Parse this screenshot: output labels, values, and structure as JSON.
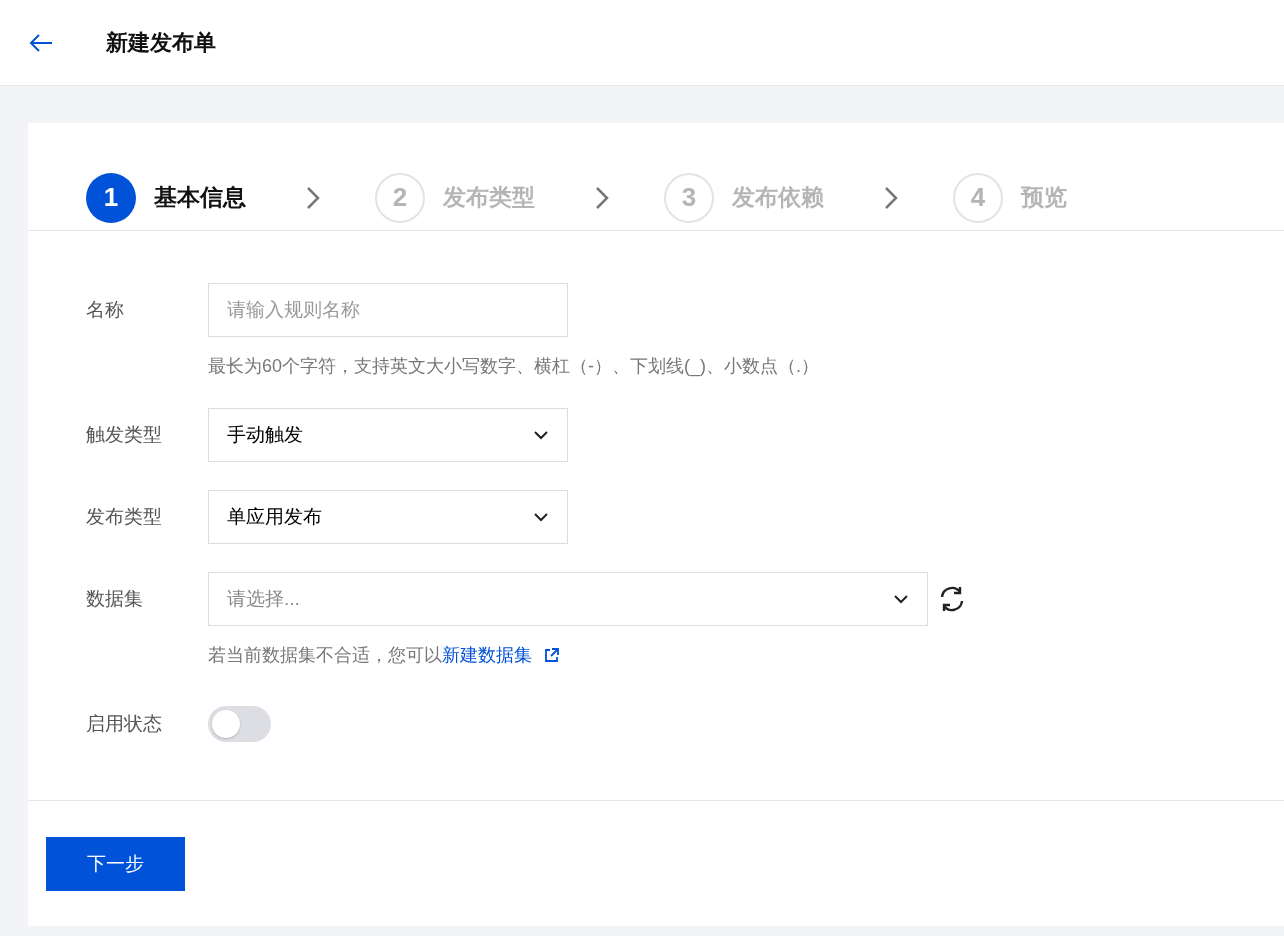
{
  "header": {
    "title": "新建发布单"
  },
  "steps": [
    {
      "number": "1",
      "label": "基本信息",
      "selected": true
    },
    {
      "number": "2",
      "label": "发布类型",
      "selected": false
    },
    {
      "number": "3",
      "label": "发布依赖",
      "selected": false
    },
    {
      "number": "4",
      "label": "预览",
      "selected": false
    }
  ],
  "form": {
    "fields": [
      {
        "kind": "text",
        "label": "名称",
        "placeholder": "请输入规则名称",
        "hint": "最长为60个字符，支持英文大小写数字、横杠（-）、下划线(_)、小数点（.）"
      },
      {
        "kind": "select",
        "label": "触发类型",
        "value": "手动触发"
      },
      {
        "kind": "select",
        "label": "发布类型",
        "value": "单应用发布"
      },
      {
        "kind": "dataset",
        "label": "数据集",
        "placeholder": "请选择...",
        "hint": "若当前数据集不合适，您可以",
        "hint_link": "新建数据集"
      },
      {
        "kind": "switch",
        "label": "启用状态",
        "on": false
      }
    ]
  },
  "next_button": "下一步"
}
